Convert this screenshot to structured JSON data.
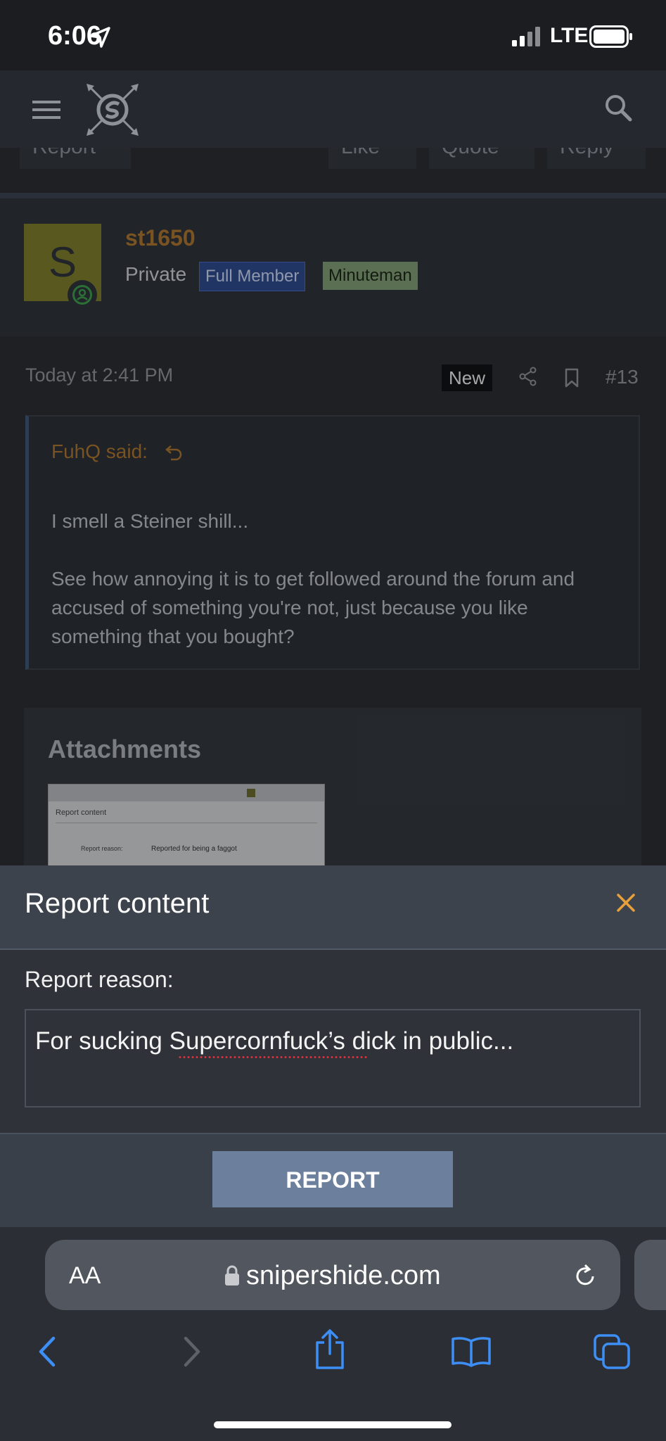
{
  "status_bar": {
    "time": "6:06",
    "network": "LTE"
  },
  "header": {
    "menu_icon": "menu-icon",
    "logo": "snipershide-logo",
    "search_icon": "search-icon"
  },
  "post_actions_partial": {
    "report": "Report",
    "like": "Like",
    "quote": "Quote",
    "reply": "Reply"
  },
  "post": {
    "avatar_letter": "S",
    "username": "st1650",
    "rank": "Private",
    "badges": [
      "Full Member",
      "Minuteman"
    ],
    "time": "Today at 2:41 PM",
    "new_label": "New",
    "post_number": "#13",
    "quote": {
      "author": "FuhQ said:",
      "text": "I smell a Steiner shill...\n\nSee how annoying it is to get followed around the forum and accused of something you're not, just because you like something that you bought?"
    },
    "attachments_title": "Attachments",
    "thumbnail": {
      "title": "Report content",
      "label": "Report reason:",
      "value": "Reported for being a faggot"
    }
  },
  "modal": {
    "title": "Report content",
    "reason_label": "Report reason:",
    "reason_value": "For sucking Supercornfuck’s dick in public...",
    "submit_label": "REPORT"
  },
  "browser": {
    "text_size_label": "AA",
    "url": "snipershide.com"
  },
  "colors": {
    "accent_username": "#a8732f",
    "close_icon": "#e8a13a",
    "report_button": "#6c7f9c",
    "safari_blue": "#3d8ff5"
  }
}
